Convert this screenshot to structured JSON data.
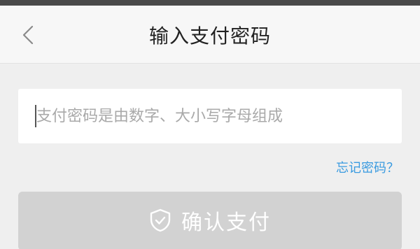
{
  "nav": {
    "title": "输入支付密码",
    "back_icon": "chevron-left-icon"
  },
  "password": {
    "placeholder": "支付密码是由数字、大小写字母组成",
    "value": ""
  },
  "forgot_link": "忘记密码？",
  "confirm": {
    "label": "确认支付",
    "icon": "shield-check-icon",
    "state": "disabled"
  },
  "colors": {
    "link": "#3a9be0",
    "button_disabled": "#d2d2d2",
    "background": "#efefef"
  }
}
